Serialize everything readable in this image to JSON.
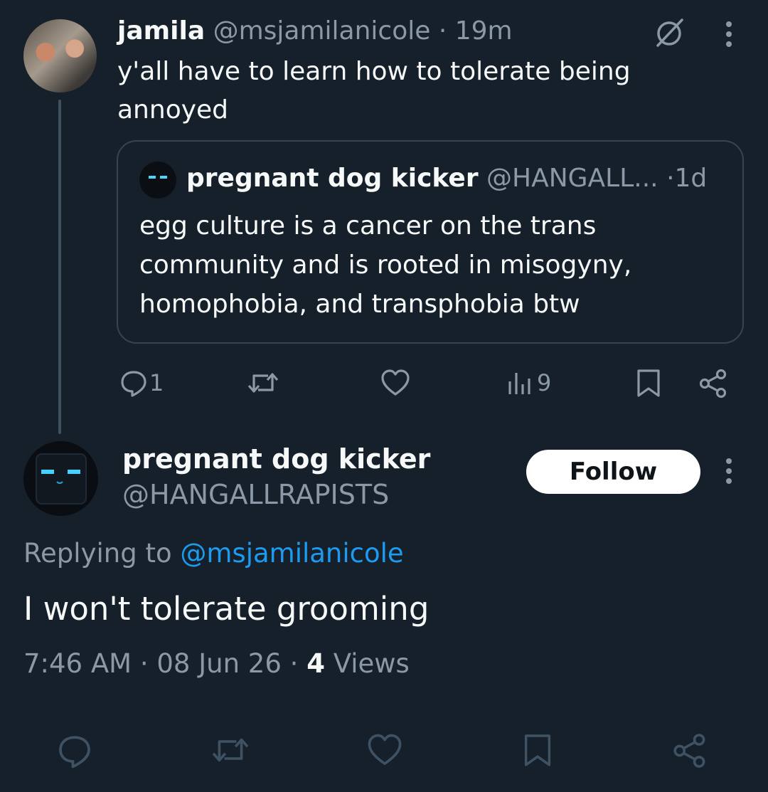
{
  "parent_tweet": {
    "display_name": "jamila",
    "handle": "@msjamilanicole",
    "separator": "·",
    "time": "19m",
    "text": "y'all have to learn how to tolerate being annoyed",
    "grok_icon": "grok-slash-icon",
    "more_icon": "more-vertical-icon"
  },
  "quoted_tweet": {
    "display_name": "pregnant dog kicker",
    "handle": "@HANGALL...",
    "separator": "·",
    "time": "1d",
    "text": "egg culture is a cancer on the trans community and is rooted in misogyny, homophobia, and transphobia btw"
  },
  "parent_actions": {
    "reply_icon": "reply-icon",
    "reply_count": "1",
    "retweet_icon": "retweet-icon",
    "like_icon": "heart-icon",
    "views_icon": "views-chart-icon",
    "views_count": "9",
    "bookmark_icon": "bookmark-icon",
    "share_icon": "share-icon"
  },
  "reply_tweet": {
    "display_name": "pregnant dog kicker",
    "handle": "@HANGALLRAPISTS",
    "follow_label": "Follow",
    "replying_prefix": "Replying to",
    "replying_handle": "@msjamilanicole",
    "text": "I won't tolerate grooming",
    "time": "7:46 AM",
    "separator": "·",
    "date": "08 Jun 26",
    "views_count": "4",
    "views_label": "Views"
  },
  "colors": {
    "background": "#15202b",
    "text": "#f7f9f9",
    "muted": "#8b98a5",
    "link": "#1d9bf0",
    "border": "#38444d"
  }
}
